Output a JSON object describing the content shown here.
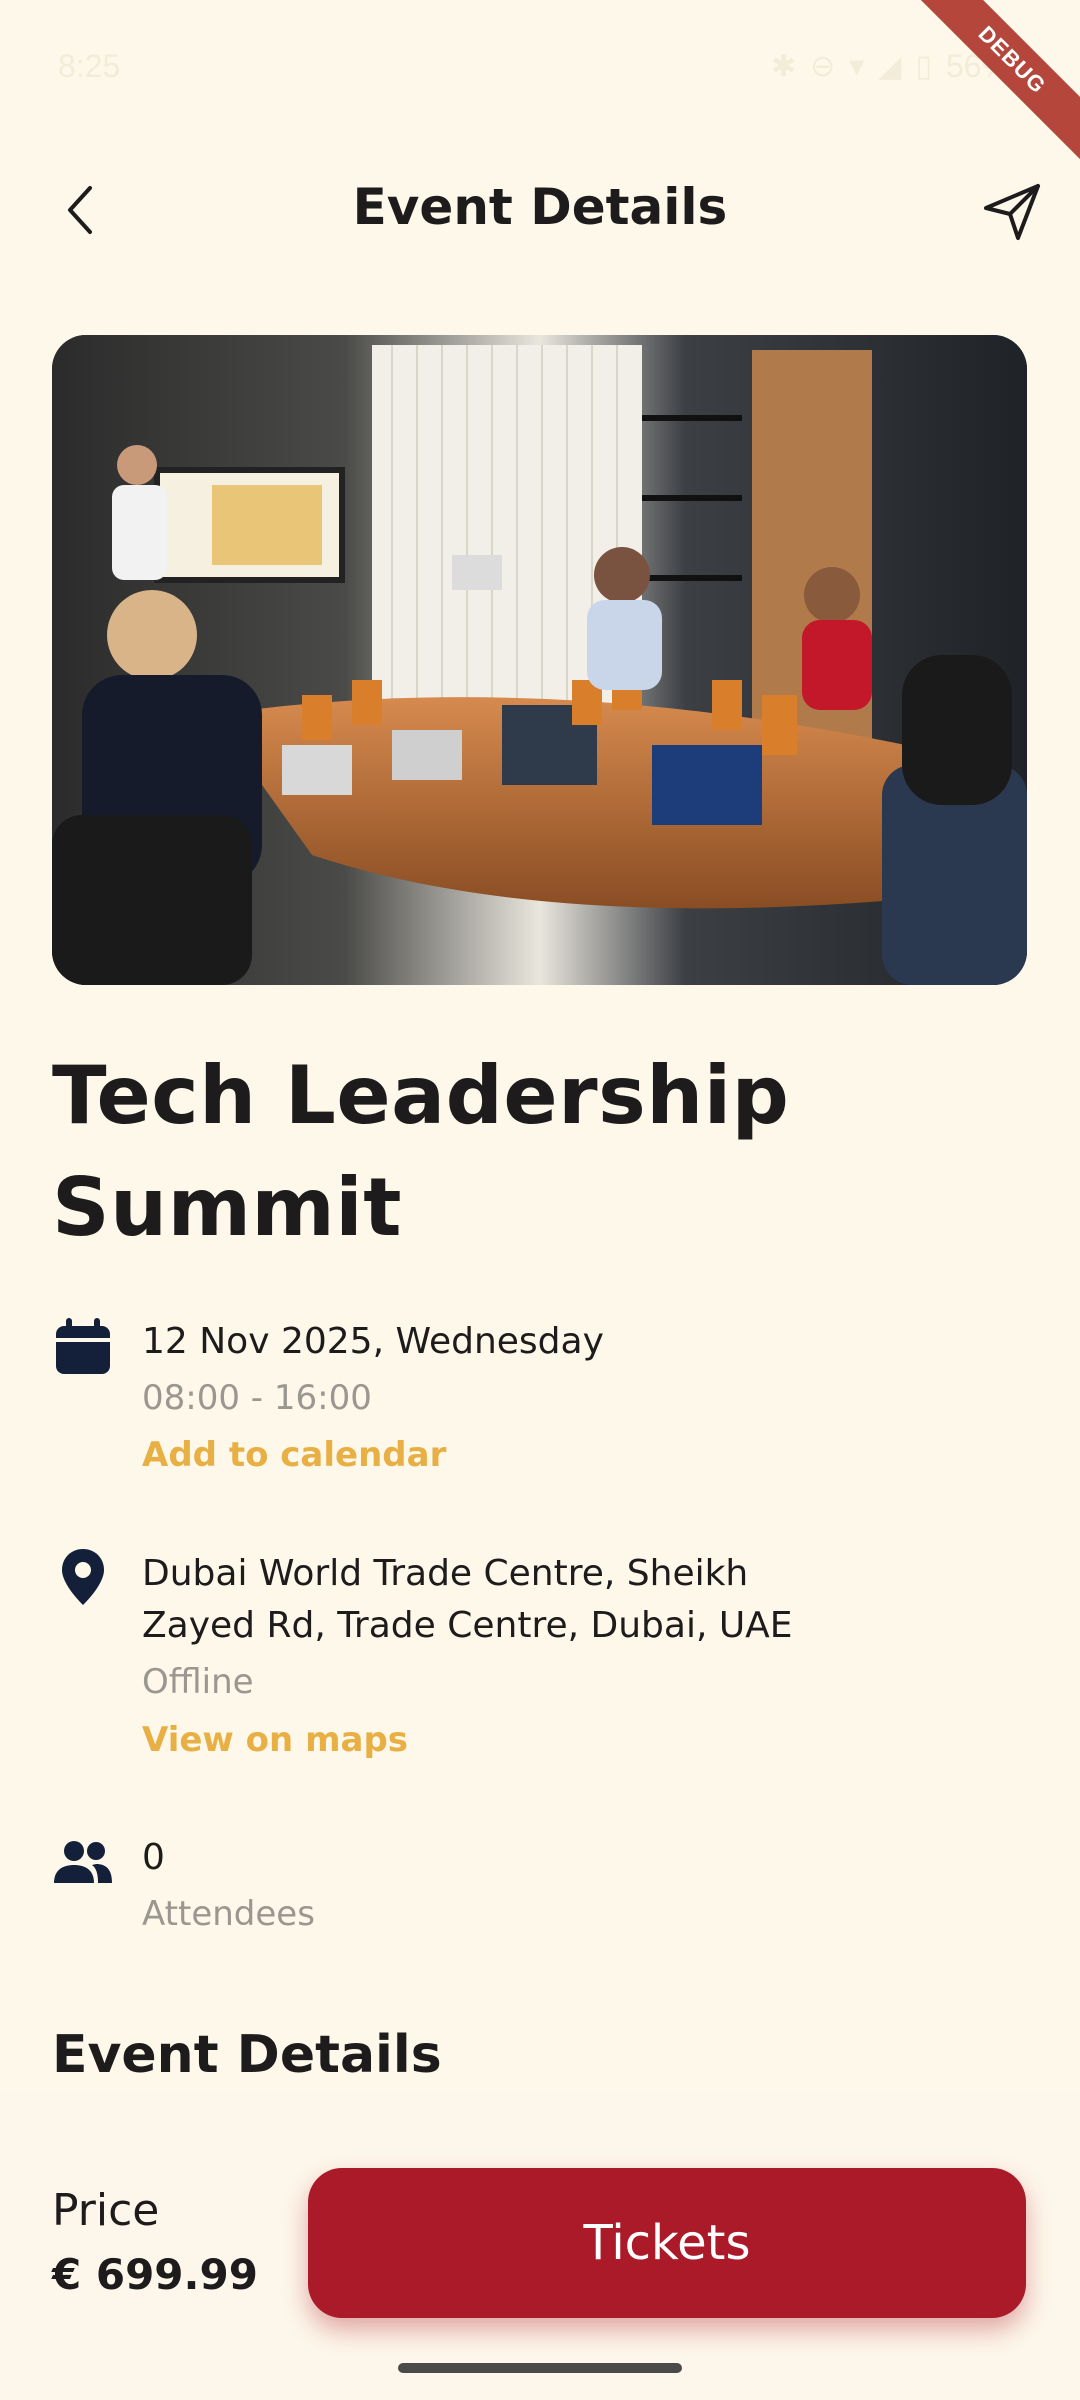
{
  "status_bar": {
    "time": "8:25",
    "battery_percent": "56%",
    "debug_label": "DEBUG"
  },
  "app_bar": {
    "title": "Event Details",
    "back_icon": "back-chevron-icon",
    "share_icon": "send-icon"
  },
  "event": {
    "title": "Tech Leadership Summit",
    "date": "12 Nov 2025, Wednesday",
    "time": "08:00 - 16:00",
    "add_to_calendar": "Add to calendar",
    "location_line1": "Dubai World Trade Centre, Sheikh",
    "location_line2": "Zayed Rd, Trade Centre, Dubai, UAE",
    "mode": "Offline",
    "view_on_maps": "View on maps",
    "attendee_count": "0",
    "attendees_label": "Attendees",
    "section_heading": "Event Details"
  },
  "footer": {
    "price_label": "Price",
    "price_value": "€ 699.99",
    "tickets_button": "Tickets"
  },
  "colors": {
    "background": "#fdf8e9",
    "accent_link": "#e8b044",
    "primary_button": "#ab1a28",
    "text": "#1e1b1c",
    "muted_text": "#9a9690"
  }
}
